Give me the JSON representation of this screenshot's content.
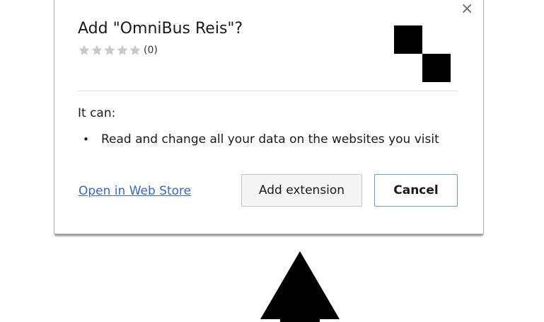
{
  "dialog": {
    "close_symbol": "×",
    "close_icon": "close-icon",
    "title": "Add \"OmniBus Reis\"?",
    "rating": {
      "stars_filled": 0,
      "stars_total": 5,
      "count_label": "(0)",
      "star_color": "#c8c8c8"
    },
    "extension_icon": {
      "name": "checkerboard-icon",
      "colors": [
        "#000000",
        "#ffffff"
      ]
    },
    "permissions": {
      "heading": "It can:",
      "bullet": "•",
      "items": [
        "Read and change all your data on the websites you visit"
      ]
    },
    "store_link": "Open in Web Store",
    "buttons": {
      "add_label": "Add extension",
      "cancel_label": "Cancel"
    },
    "colors": {
      "link": "#3367d6",
      "cancel_border": "#6b9ddb"
    }
  },
  "pointer_arrow": {
    "icon": "up-arrow-icon",
    "color": "#000000"
  }
}
